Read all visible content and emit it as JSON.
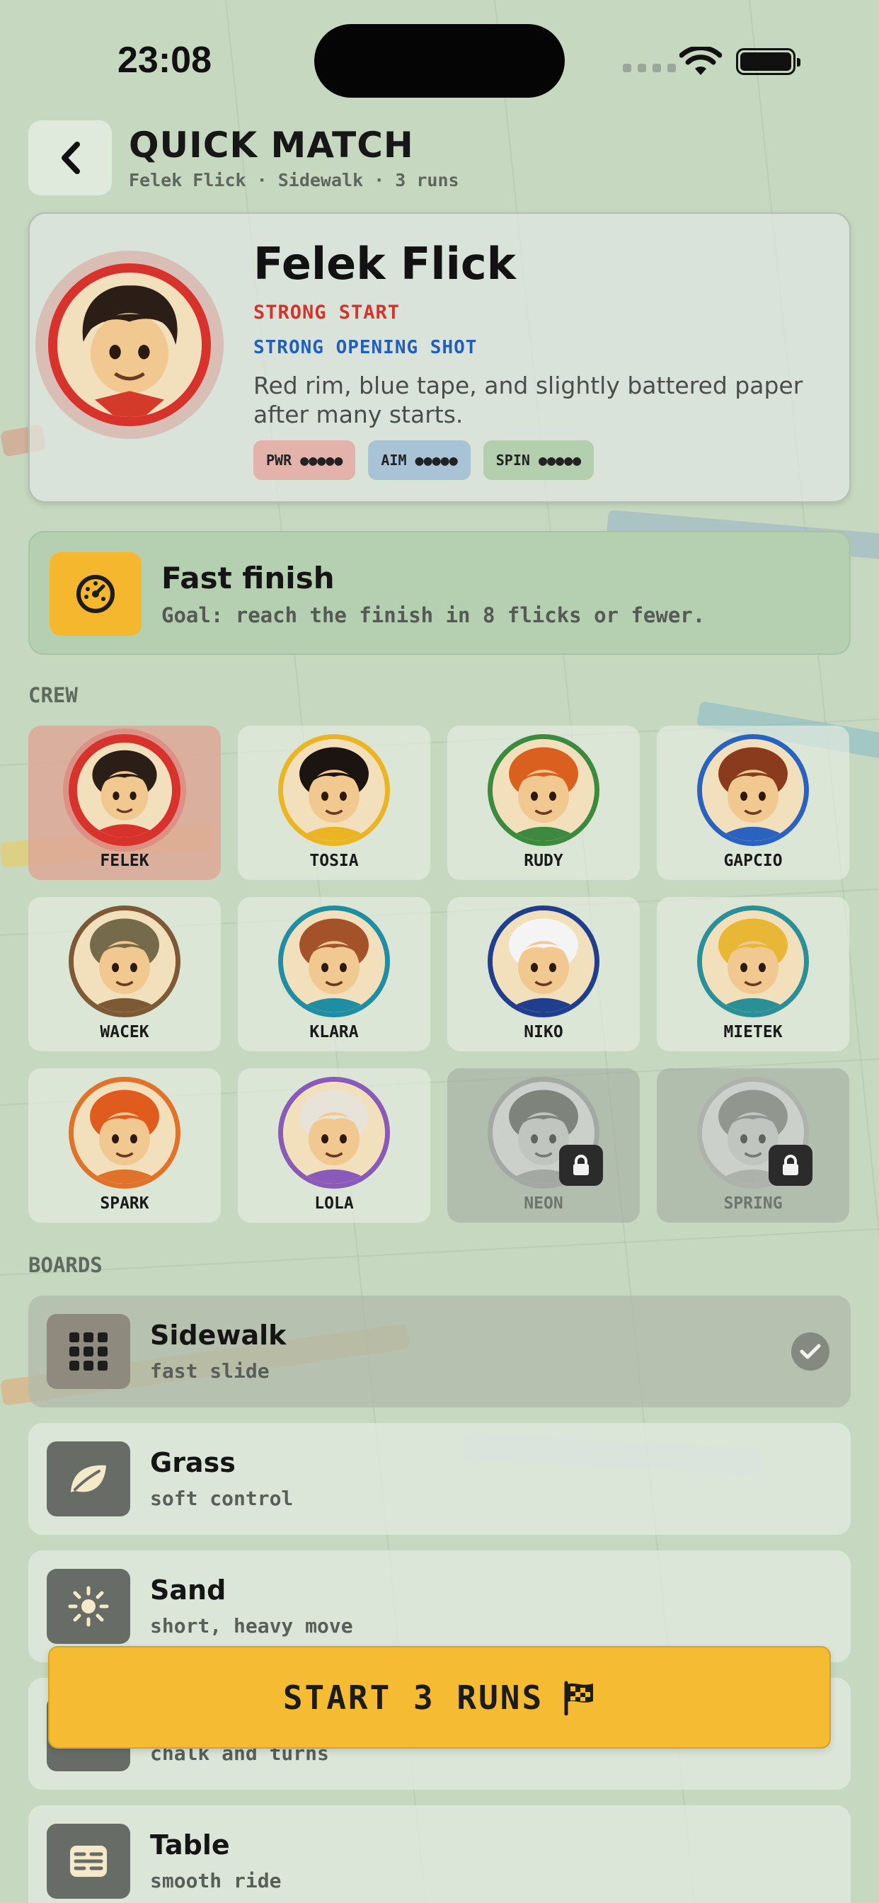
{
  "status": {
    "time": "23:08"
  },
  "header": {
    "title": "QUICK MATCH",
    "subtitle": "Felek Flick · Sidewalk · 3 runs"
  },
  "hero": {
    "name": "Felek Flick",
    "trait": "STRONG START",
    "shot": "STRONG OPENING SHOT",
    "description": "Red rim, blue tape, and slightly battered paper after many starts.",
    "stats": [
      {
        "label": "PWR ●●●●●",
        "color": "#e3b2aa"
      },
      {
        "label": "AIM ●●●●●",
        "color": "#a9c3d6"
      },
      {
        "label": "SPIN ●●●●●",
        "color": "#b3cfae"
      }
    ]
  },
  "goal": {
    "title": "Fast finish",
    "text": "Goal: reach the finish in 8 flicks or fewer."
  },
  "crew": {
    "label": "CREW",
    "members": [
      {
        "name": "FELEK",
        "ring": "#d8322c",
        "hair": "#2a1e16",
        "selected": true,
        "locked": false
      },
      {
        "name": "TOSIA",
        "ring": "#eab422",
        "hair": "#1b1411",
        "selected": false,
        "locked": false
      },
      {
        "name": "RUDY",
        "ring": "#3d8a3f",
        "hair": "#d9601f",
        "selected": false,
        "locked": false
      },
      {
        "name": "GAPCIO",
        "ring": "#2a62c0",
        "hair": "#8a3b1e",
        "selected": false,
        "locked": false
      },
      {
        "name": "WACEK",
        "ring": "#7d5a35",
        "hair": "#756a4a",
        "selected": false,
        "locked": false
      },
      {
        "name": "KLARA",
        "ring": "#1f8ea3",
        "hair": "#a4522a",
        "selected": false,
        "locked": false
      },
      {
        "name": "NIKO",
        "ring": "#1f3f8e",
        "hair": "#f4f4f4",
        "selected": false,
        "locked": false
      },
      {
        "name": "MIETEK",
        "ring": "#2a8f96",
        "hair": "#e8b735",
        "selected": false,
        "locked": false
      },
      {
        "name": "SPARK",
        "ring": "#e0722a",
        "hair": "#e05b1e",
        "selected": false,
        "locked": false
      },
      {
        "name": "LOLA",
        "ring": "#8a5ab8",
        "hair": "#e8e3d8",
        "selected": false,
        "locked": false
      },
      {
        "name": "NEON",
        "ring": "#999999",
        "hair": "#555555",
        "selected": false,
        "locked": true
      },
      {
        "name": "SPRING",
        "ring": "#aaaaaa",
        "hair": "#777777",
        "selected": false,
        "locked": true
      }
    ]
  },
  "boards": {
    "label": "BOARDS",
    "items": [
      {
        "name": "Sidewalk",
        "desc": "fast slide",
        "icon": "grid-icon",
        "active": true
      },
      {
        "name": "Grass",
        "desc": "soft control",
        "icon": "leaf-icon",
        "active": false
      },
      {
        "name": "Sand",
        "desc": "short, heavy move",
        "icon": "sun-icon",
        "active": false
      },
      {
        "name": "",
        "desc": "chalk and turns",
        "icon": "chalk-icon",
        "active": false
      },
      {
        "name": "Table",
        "desc": "smooth ride",
        "icon": "table-icon",
        "active": false
      }
    ]
  },
  "start": {
    "label": "START 3 RUNS"
  }
}
